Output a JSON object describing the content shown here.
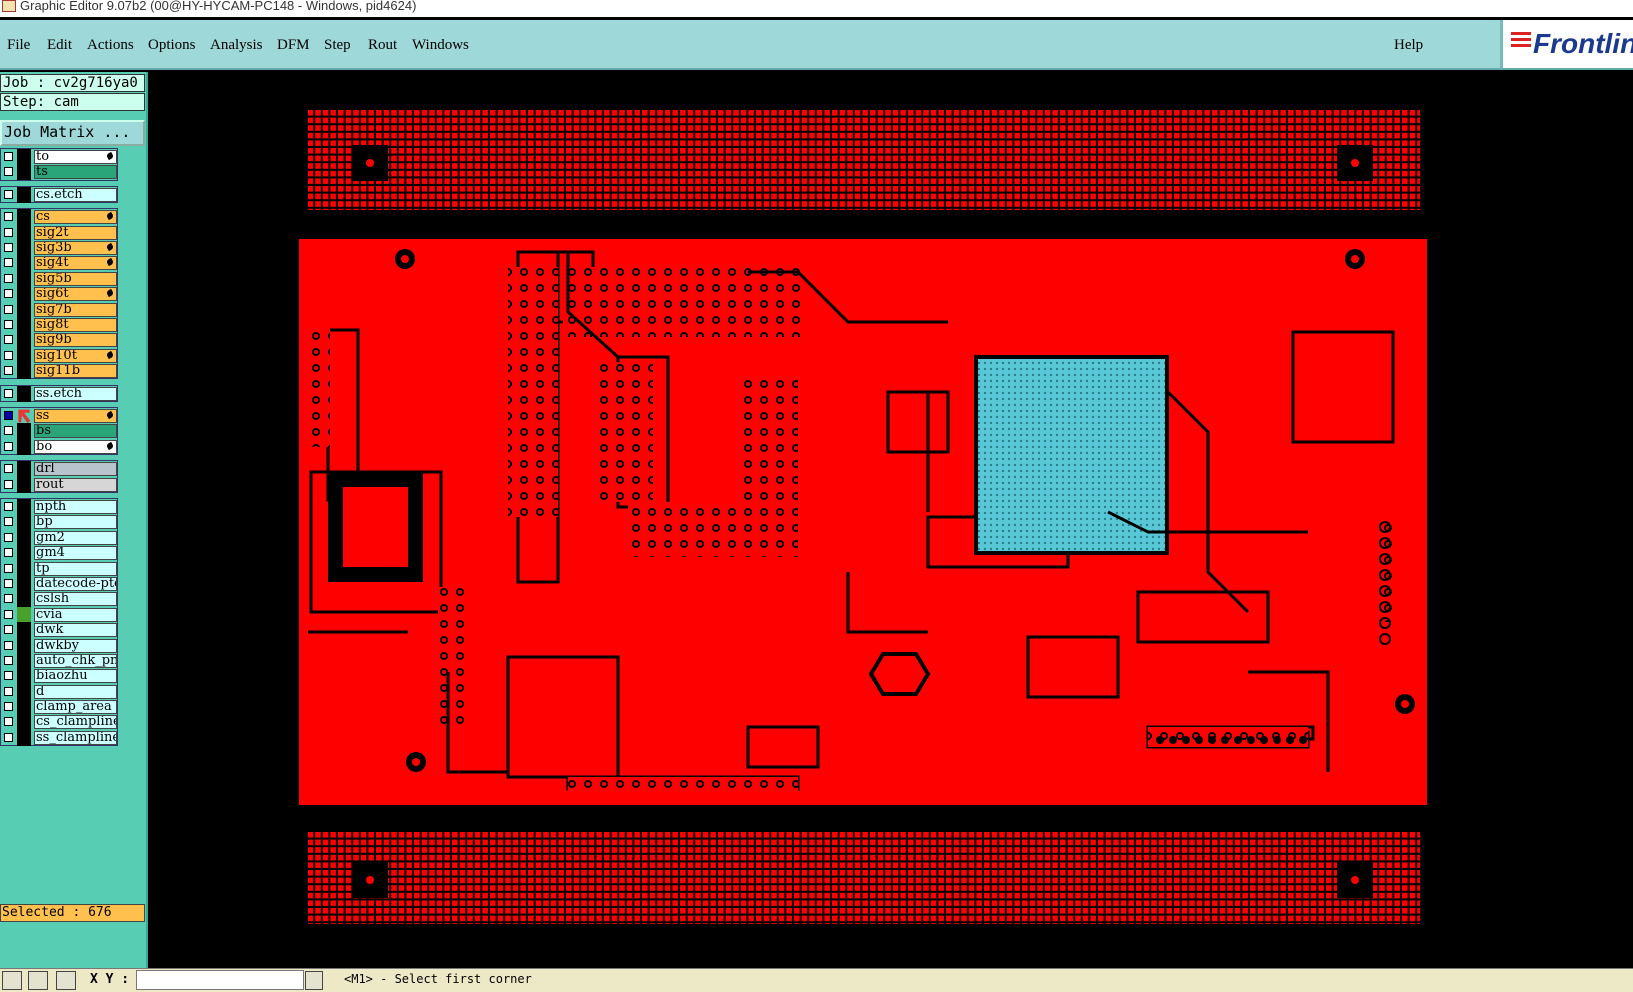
{
  "window": {
    "title": "Graphic Editor 9.07b2 (00@HY-HYCAM-PC148 - Windows, pid4624)"
  },
  "menu": {
    "items": [
      "File",
      "Edit",
      "Actions",
      "Options",
      "Analysis",
      "DFM",
      "Step",
      "Rout",
      "Windows"
    ],
    "help": "Help",
    "logo": "Frontline"
  },
  "panel": {
    "job": "Job : cv2g716ya0",
    "step": "Step: cam",
    "job_matrix_button": "Job Matrix ..."
  },
  "layers": {
    "groups": [
      {
        "name": "top-layers",
        "rows": [
          {
            "label": "to",
            "color": "c-white",
            "locked": true
          },
          {
            "label": "ts",
            "color": "c-teal",
            "locked": false
          }
        ]
      },
      {
        "name": "cs-etch",
        "rows": [
          {
            "label": "cs.etch",
            "color": "c-light",
            "locked": false
          }
        ]
      },
      {
        "name": "signal-layers",
        "rows": [
          {
            "label": "cs",
            "color": "c-orange",
            "locked": true
          },
          {
            "label": "sig2t",
            "color": "c-orange",
            "locked": false
          },
          {
            "label": "sig3b",
            "color": "c-orange",
            "locked": true
          },
          {
            "label": "sig4t",
            "color": "c-orange",
            "locked": true
          },
          {
            "label": "sig5b",
            "color": "c-orange",
            "locked": false
          },
          {
            "label": "sig6t",
            "color": "c-orange",
            "locked": true
          },
          {
            "label": "sig7b",
            "color": "c-orange",
            "locked": false
          },
          {
            "label": "sig8t",
            "color": "c-orange",
            "locked": false
          },
          {
            "label": "sig9b",
            "color": "c-orange",
            "locked": false
          },
          {
            "label": "sig10t",
            "color": "c-orange",
            "locked": true
          },
          {
            "label": "sig11b",
            "color": "c-orange",
            "locked": false
          }
        ]
      },
      {
        "name": "ss-etch",
        "rows": [
          {
            "label": "ss.etch",
            "color": "c-light",
            "locked": false
          }
        ]
      },
      {
        "name": "bottom-layers",
        "rows": [
          {
            "label": "ss",
            "color": "c-orange",
            "locked": true,
            "active": true
          },
          {
            "label": "bs",
            "color": "c-teal",
            "locked": false
          },
          {
            "label": "bo",
            "color": "c-white",
            "locked": true
          }
        ]
      },
      {
        "name": "drill-layers",
        "rows": [
          {
            "label": "drl",
            "color": "c-slate",
            "locked": false
          },
          {
            "label": "rout",
            "color": "c-grey",
            "locked": false
          }
        ]
      },
      {
        "name": "doc-layers",
        "rows": [
          {
            "label": "npth",
            "color": "c-light",
            "locked": false
          },
          {
            "label": "bp",
            "color": "c-light",
            "locked": false
          },
          {
            "label": "gm2",
            "color": "c-light",
            "locked": false
          },
          {
            "label": "gm4",
            "color": "c-light",
            "locked": false
          },
          {
            "label": "tp",
            "color": "c-light",
            "locked": false
          },
          {
            "label": "datecode-pto",
            "color": "c-light",
            "locked": false
          },
          {
            "label": "cslsh",
            "color": "c-light",
            "locked": false
          },
          {
            "label": "cvia",
            "color": "c-light",
            "locked": false,
            "green": true
          },
          {
            "label": "dwk",
            "color": "c-light",
            "locked": false
          },
          {
            "label": "dwkby",
            "color": "c-light",
            "locked": false
          },
          {
            "label": "auto_chk_pnl",
            "color": "c-light",
            "locked": false
          },
          {
            "label": "biaozhu",
            "color": "c-light",
            "locked": false
          },
          {
            "label": "d",
            "color": "c-light",
            "locked": false
          },
          {
            "label": "clamp_area",
            "color": "c-light",
            "locked": false
          },
          {
            "label": "cs_clampline",
            "color": "c-light",
            "locked": false
          },
          {
            "label": "ss_clampline",
            "color": "c-light",
            "locked": false
          }
        ]
      }
    ]
  },
  "status": {
    "selected": "Selected : 676",
    "xy_label": "X Y :",
    "xy_value": "",
    "message": "<M1> - Select first corner"
  },
  "colors": {
    "copper": "#ff0000",
    "void": "#000000",
    "bga": "#59c8d6",
    "menubar": "#9fd8d8",
    "panel": "#57cdb4"
  }
}
